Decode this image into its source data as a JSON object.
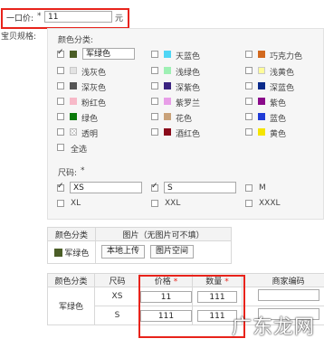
{
  "price_row": {
    "label": "一口价:",
    "required": "*",
    "value": "11",
    "unit": "元"
  },
  "spec_label": "宝贝规格:",
  "color_section": {
    "title": "颜色分类:",
    "first_name_value": "军绿色",
    "colors": [
      {
        "name": "军绿色",
        "hex": "#4b5e27",
        "checked": true
      },
      {
        "name": "天蓝色",
        "hex": "#4fd6f5",
        "checked": false
      },
      {
        "name": "巧克力色",
        "hex": "#d2691e",
        "checked": false
      },
      {
        "name": "浅灰色",
        "hex": "#e3e3e3",
        "checked": false
      },
      {
        "name": "浅绿色",
        "hex": "#9ef0b4",
        "checked": false
      },
      {
        "name": "浅黄色",
        "hex": "#fffb99",
        "checked": false
      },
      {
        "name": "深灰色",
        "hex": "#555555",
        "checked": false
      },
      {
        "name": "深紫色",
        "hex": "#3a2380",
        "checked": false
      },
      {
        "name": "深蓝色",
        "hex": "#0a2a8a",
        "checked": false
      },
      {
        "name": "粉红色",
        "hex": "#f7b9c8",
        "checked": false
      },
      {
        "name": "紫罗兰",
        "hex": "#e89ee8",
        "checked": false
      },
      {
        "name": "紫色",
        "hex": "#8a0a8a",
        "checked": false
      },
      {
        "name": "绿色",
        "hex": "#0a7a0a",
        "checked": false
      },
      {
        "name": "花色",
        "hex": "#c9a27a",
        "checked": false
      },
      {
        "name": "蓝色",
        "hex": "#1f3bd6",
        "checked": false
      },
      {
        "name": "透明",
        "hex": "transparent",
        "checked": false
      },
      {
        "name": "酒红色",
        "hex": "#8a0a1a",
        "checked": false
      },
      {
        "name": "黄色",
        "hex": "#f5e400",
        "checked": false
      }
    ],
    "select_all": "全选"
  },
  "size_section": {
    "title": "尺码:",
    "required": "*",
    "sizes": [
      {
        "name": "XS",
        "checked": true,
        "editable": true
      },
      {
        "name": "S",
        "checked": true,
        "editable": true
      },
      {
        "name": "M",
        "checked": false,
        "editable": false
      },
      {
        "name": "XL",
        "checked": false,
        "editable": false
      },
      {
        "name": "XXL",
        "checked": false,
        "editable": false
      },
      {
        "name": "XXXL",
        "checked": false,
        "editable": false
      }
    ]
  },
  "image_table": {
    "headers": [
      "颜色分类",
      "图片（无图片可不填）"
    ],
    "row": {
      "color": "军绿色",
      "color_hex": "#4b5e27",
      "upload_label": "本地上传",
      "space_label": "图片空间"
    }
  },
  "sku_table": {
    "headers": [
      "颜色分类",
      "尺码",
      "价格",
      "数量",
      "商家编码"
    ],
    "required": "*",
    "group_color": "军绿色",
    "rows": [
      {
        "size": "XS",
        "price": "11",
        "qty": "111",
        "code": ""
      },
      {
        "size": "S",
        "price": "111",
        "qty": "111",
        "code": ""
      }
    ]
  },
  "watermark": "广东龙网"
}
